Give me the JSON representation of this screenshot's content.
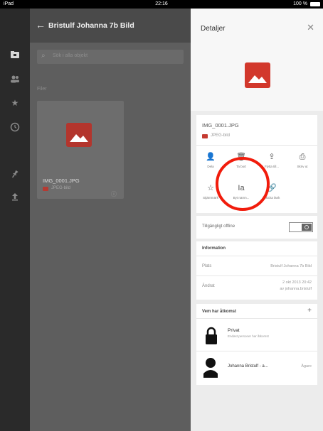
{
  "status_bar": {
    "carrier": "iPad",
    "time": "22:16",
    "battery": "100 %"
  },
  "main": {
    "title": "Bristulf Johanna 7b Bild",
    "search_placeholder": "Sök i alla objekt",
    "section_label": "Filer",
    "file": {
      "name": "IMG_0001.JPG",
      "type": "JPEG-bild"
    }
  },
  "details": {
    "title": "Detaljer",
    "file_name": "IMG_0001.JPG",
    "file_type": "JPEG-bild",
    "actions_row1": [
      "Dela",
      "Ta bort",
      "Flytta till...",
      "Skriv ut"
    ],
    "actions_row2": [
      "Stjärnmärk",
      "Byt namn...",
      "Skicka länk"
    ],
    "offline_label": "Tillgängligt offline",
    "offline_enabled": true,
    "info_heading": "Information",
    "location_label": "Plats",
    "location_value": "Bristulf Johanna 7b Bild",
    "modified_label": "Ändrat",
    "modified_value": "2 okt 2013 20:42",
    "modified_by": "av johanna.bristulf",
    "access_heading": "Vem har åtkomst",
    "privacy_name": "Privat",
    "privacy_desc": "Endast personer har åtkomst",
    "owner_name": "Johanna Bristulf - a...",
    "owner_role": "Ägare"
  },
  "colors": {
    "accent_red": "#d2382c",
    "highlight_circle": "#f11c0c"
  }
}
